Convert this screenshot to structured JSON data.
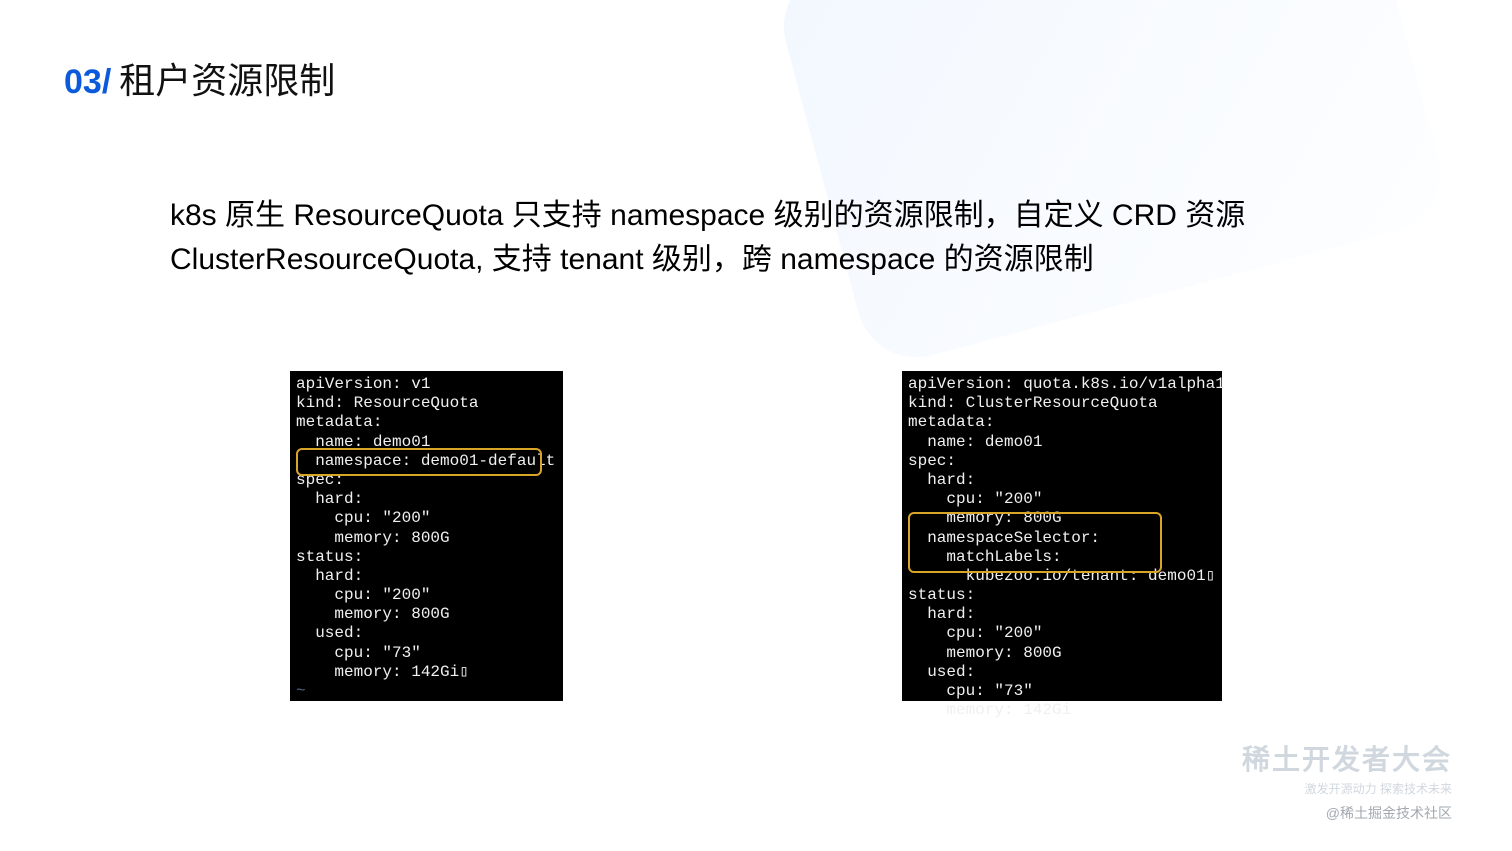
{
  "header": {
    "number": "03/",
    "title": "租户资源限制"
  },
  "description": "k8s 原生 ResourceQuota 只支持 namespace 级别的资源限制，自定义 CRD 资源 ClusterResourceQuota, 支持 tenant 级别，跨 namespace 的资源限制",
  "code_left": "apiVersion: v1\nkind: ResourceQuota\nmetadata:\n  name: demo01\n  namespace: demo01-default\nspec:\n  hard:\n    cpu: \"200\"\n    memory: 800G\nstatus:\n  hard:\n    cpu: \"200\"\n    memory: 800G\n  used:\n    cpu: \"73\"\n    memory: 142Gi▯",
  "code_left_tilde": "~",
  "code_right": "apiVersion: quota.k8s.io/v1alpha1\nkind: ClusterResourceQuota\nmetadata:\n  name: demo01\nspec:\n  hard:\n    cpu: \"200\"\n    memory: 800G\n  namespaceSelector:\n    matchLabels:\n      kubezoo.io/tenant: demo01▯\nstatus:\n  hard:\n    cpu: \"200\"\n    memory: 800G\n  used:\n    cpu: \"73\"\n    memory: 142Gi",
  "watermark": {
    "main": "稀土开发者大会",
    "sub": "激发开源动力 探索技术未来",
    "attr": "@稀土掘金技术社区"
  }
}
